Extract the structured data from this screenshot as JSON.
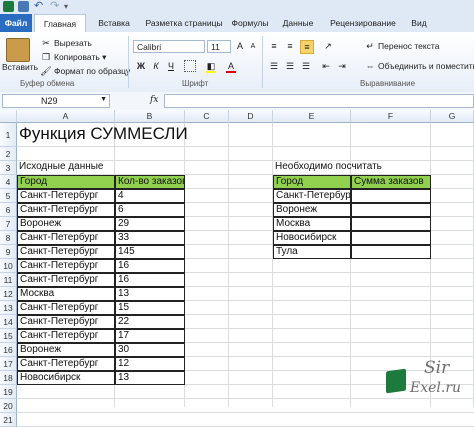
{
  "tabs": {
    "file": "Файл",
    "home": "Главная",
    "insert": "Вставка",
    "page_layout": "Разметка страницы",
    "formulas": "Формулы",
    "data": "Данные",
    "review": "Рецензирование",
    "view": "Вид"
  },
  "clipboard": {
    "paste": "Вставить",
    "cut": "Вырезать",
    "copy": "Копировать ▾",
    "format_painter": "Формат по образцу",
    "group": "Буфер обмена"
  },
  "font": {
    "name": "Calibri",
    "size": "11",
    "group": "Шрифт",
    "bold": "Ж",
    "italic": "К",
    "underline": "Ч"
  },
  "alignment": {
    "wrap": "Перенос текста",
    "merge": "Объединить и поместить",
    "group": "Выравнивание"
  },
  "formula_bar": {
    "name_box": "N29",
    "fx": "fx",
    "value": ""
  },
  "columns": [
    "A",
    "B",
    "C",
    "D",
    "E",
    "F",
    "G"
  ],
  "rows": [
    "1",
    "2",
    "3",
    "4",
    "5",
    "6",
    "7",
    "8",
    "9",
    "10",
    "11",
    "12",
    "13",
    "14",
    "15",
    "16",
    "17",
    "18",
    "19",
    "20",
    "21"
  ],
  "sheet": {
    "title": "Функция СУММЕСЛИ",
    "source_label": "Исходные данные",
    "target_label": "Необходимо посчитать",
    "src_headers": [
      "Город",
      "Кол-во заказов"
    ],
    "src_rows": [
      [
        "Санкт-Петербург",
        "4"
      ],
      [
        "Санкт-Петербург",
        "6"
      ],
      [
        "Воронеж",
        "29"
      ],
      [
        "Санкт-Петербург",
        "33"
      ],
      [
        "Санкт-Петербург",
        "145"
      ],
      [
        "Санкт-Петербург",
        "16"
      ],
      [
        "Санкт-Петербург",
        "16"
      ],
      [
        "Москва",
        "13"
      ],
      [
        "Санкт-Петербург",
        "15"
      ],
      [
        "Санкт-Петербург",
        "22"
      ],
      [
        "Санкт-Петербург",
        "17"
      ],
      [
        "Воронеж",
        "30"
      ],
      [
        "Санкт-Петербург",
        "12"
      ],
      [
        "Новосибирск",
        "13"
      ]
    ],
    "tgt_headers": [
      "Город",
      "Сумма заказов"
    ],
    "tgt_rows": [
      [
        "Санкт-Петербург",
        ""
      ],
      [
        "Воронеж",
        ""
      ],
      [
        "Москва",
        ""
      ],
      [
        "Новосибирск",
        ""
      ],
      [
        "Тула",
        ""
      ]
    ]
  },
  "watermark": {
    "line1": "Sir",
    "line2": "Exel.ru"
  },
  "colors": {
    "header_fill": "#92d050",
    "file_tab": "#2a6cc0",
    "ribbon": "#dfe9f5"
  }
}
